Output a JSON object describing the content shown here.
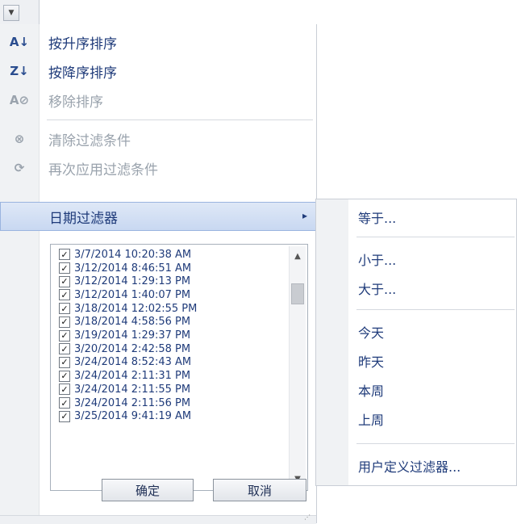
{
  "menu": {
    "sort_asc": {
      "label": "按升序排序",
      "icon": "sort-ascending-icon"
    },
    "sort_desc": {
      "label": "按降序排序",
      "icon": "sort-descending-icon"
    },
    "remove_sort": {
      "label": "移除排序",
      "icon": "remove-sort-icon"
    },
    "clear_filter": {
      "label": "清除过滤条件",
      "icon": "clear-filter-icon"
    },
    "reapply_filter": {
      "label": "再次应用过滤条件",
      "icon": "reapply-filter-icon"
    },
    "date_filters": {
      "label": "日期过滤器",
      "arrow": "▸"
    }
  },
  "checklist": {
    "items": [
      "3/7/2014 10:20:38 AM",
      "3/12/2014 8:46:51 AM",
      "3/12/2014 1:29:13 PM",
      "3/12/2014 1:40:07 PM",
      "3/18/2014 12:02:55 PM",
      "3/18/2014 4:58:56 PM",
      "3/19/2014 1:29:37 PM",
      "3/20/2014 2:42:58 PM",
      "3/24/2014 8:52:43 AM",
      "3/24/2014 2:11:31 PM",
      "3/24/2014 2:11:55 PM",
      "3/24/2014 2:11:56 PM",
      "3/25/2014 9:41:19 AM"
    ],
    "checked": true
  },
  "buttons": {
    "ok": "确定",
    "cancel": "取消"
  },
  "submenu": {
    "equals": "等于...",
    "less_than": "小于...",
    "greater_than": "大于...",
    "today": "今天",
    "yesterday": "昨天",
    "this_week": "本周",
    "last_week": "上周",
    "custom": "用户定义过滤器..."
  },
  "colors": {
    "text": "#1f3b7a",
    "disabled": "#9aa3ad",
    "highlight": "#c8d8f1"
  }
}
